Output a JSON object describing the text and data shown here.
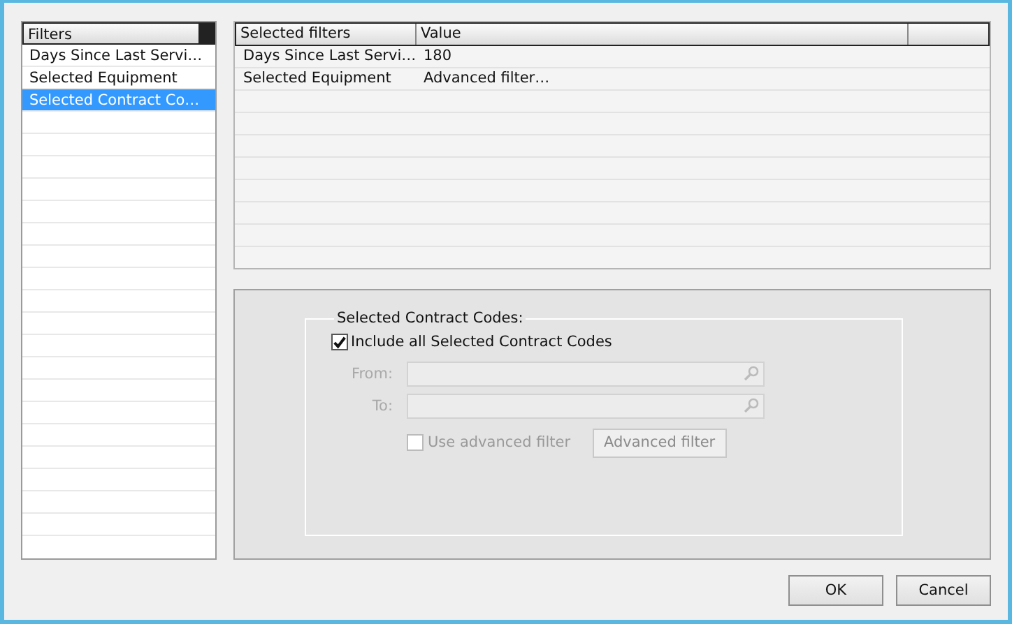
{
  "filters": {
    "header": "Filters",
    "items": [
      {
        "label": "Days Since Last Servi…",
        "selected": false
      },
      {
        "label": "Selected Equipment",
        "selected": false
      },
      {
        "label": "Selected Contract Co…",
        "selected": true
      }
    ]
  },
  "grid": {
    "columns": [
      "Selected filters",
      "Value"
    ],
    "rows": [
      {
        "cells": [
          "Days Since Last Servi…",
          "180"
        ]
      },
      {
        "cells": [
          "Selected Equipment",
          "Advanced filter…"
        ]
      }
    ]
  },
  "group": {
    "title": "Selected Contract Codes:",
    "include": {
      "label": "Include all Selected Contract Codes",
      "checked": true
    },
    "fields": [
      {
        "label": "From:",
        "disabled": true
      },
      {
        "label": "To:",
        "disabled": true
      }
    ],
    "advanced_check": {
      "label": "Use advanced filter",
      "checked": false,
      "disabled": true
    },
    "advanced_button": {
      "label": "Advanced filter",
      "disabled": true
    }
  },
  "buttons": [
    "OK",
    "Cancel"
  ]
}
